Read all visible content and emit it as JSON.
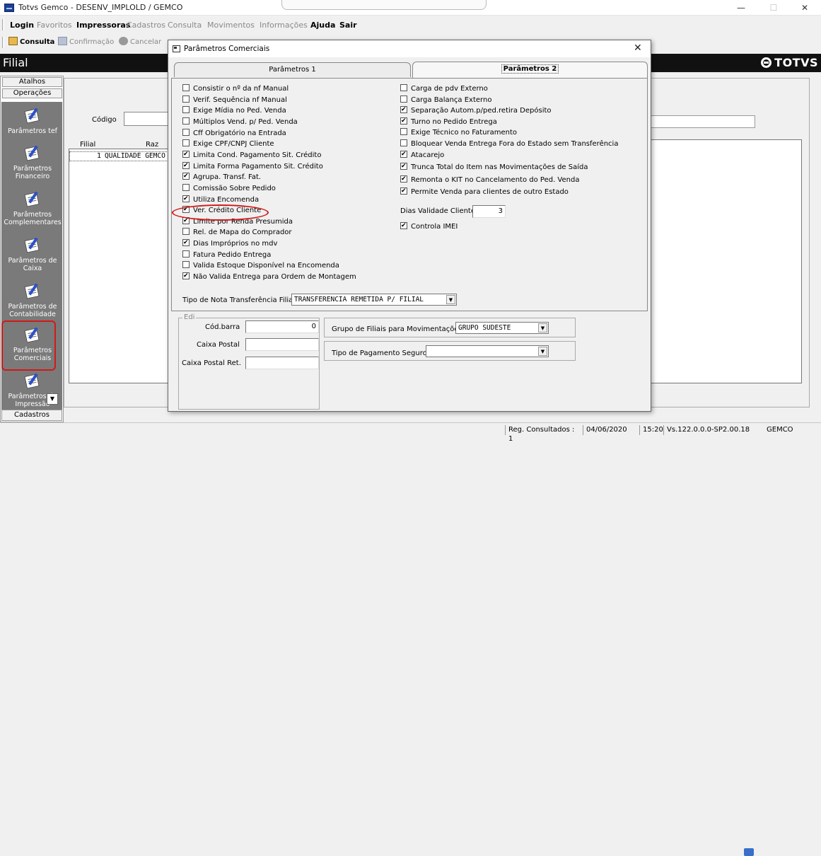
{
  "window": {
    "title": "Totvs Gemco - DESENV_IMPLOLD / GEMCO",
    "controls": [
      "—",
      "☐",
      "✕"
    ]
  },
  "menu": {
    "items": [
      {
        "label": "Login",
        "enabled": true
      },
      {
        "label": "Favoritos",
        "enabled": false
      },
      {
        "label": "Impressoras",
        "enabled": true
      },
      {
        "label": "Cadastros",
        "enabled": false
      },
      {
        "label": "Consulta",
        "enabled": false
      },
      {
        "label": "Movimentos",
        "enabled": false
      },
      {
        "label": "Informações",
        "enabled": false
      },
      {
        "label": "Ajuda",
        "enabled": true
      },
      {
        "label": "Sair",
        "enabled": true
      }
    ]
  },
  "toolbar": {
    "consulta": "Consulta",
    "confirmacao": "Confirmação",
    "cancelar": "Cancelar"
  },
  "header": {
    "title": "Filial",
    "logo": "TOTVS"
  },
  "sidebar": {
    "tabs": [
      "Atalhos",
      "Operações"
    ],
    "items": [
      {
        "label": "Parâmetros tef"
      },
      {
        "label": "Parâmetros Financeiro"
      },
      {
        "label": "Parâmetros Complementares"
      },
      {
        "label": "Parâmetros de Caixa"
      },
      {
        "label": "Parâmetros de Contabilidade"
      },
      {
        "label": "Parâmetros Comerciais"
      },
      {
        "label": "Parâmetros de Impressão"
      }
    ],
    "bottom_tab": "Cadastros"
  },
  "background_form": {
    "codigo_label": "Código",
    "table_headers": [
      "Filial",
      "Raz"
    ],
    "row": {
      "filial": "1",
      "razao": "QUALIDADE GEMCO"
    }
  },
  "dialog": {
    "title": "Parâmetros Comerciais",
    "close": "✕",
    "tabs": [
      "Parâmetros 1",
      "Parâmetros 2"
    ],
    "active_tab": "Parâmetros 2",
    "left_checks": [
      {
        "label": "Consistir o nº da nf Manual",
        "checked": false
      },
      {
        "label": "Verif. Sequência nf Manual",
        "checked": false
      },
      {
        "label": "Exige Mídia no Ped. Venda",
        "checked": false
      },
      {
        "label": "Múltiplos Vend. p/ Ped. Venda",
        "checked": false
      },
      {
        "label": "Cff Obrigatório na Entrada",
        "checked": false
      },
      {
        "label": "Exige CPF/CNPJ Cliente",
        "checked": false
      },
      {
        "label": "Limita Cond. Pagamento Sit. Crédito",
        "checked": true
      },
      {
        "label": "Limita Forma Pagamento Sit. Crédito",
        "checked": true
      },
      {
        "label": "Agrupa. Transf. Fat.",
        "checked": true
      },
      {
        "label": "Comissão Sobre Pedido",
        "checked": false
      },
      {
        "label": "Utiliza Encomenda",
        "checked": true
      },
      {
        "label": "Ver. Crédito Cliente",
        "checked": true
      },
      {
        "label": "Limite por Renda Presumida",
        "checked": true
      },
      {
        "label": "Rel. de Mapa do Comprador",
        "checked": false
      },
      {
        "label": "Dias Impróprios no mdv",
        "checked": true
      },
      {
        "label": "Fatura Pedido Entrega",
        "checked": false
      },
      {
        "label": "Valida Estoque Disponível na Encomenda",
        "checked": false
      },
      {
        "label": "Não Valida Entrega para Ordem de Montagem",
        "checked": true
      }
    ],
    "right_checks": [
      {
        "label": "Carga de pdv Externo",
        "checked": false
      },
      {
        "label": "Carga Balança Externo",
        "checked": false
      },
      {
        "label": "Separação Autom.p/ped.retira Depósito",
        "checked": true
      },
      {
        "label": "Turno no Pedido Entrega",
        "checked": true
      },
      {
        "label": "Exige Técnico no Faturamento",
        "checked": false
      },
      {
        "label": "Bloquear Venda Entrega Fora do Estado sem Transferência",
        "checked": false
      },
      {
        "label": "Atacarejo",
        "checked": true
      },
      {
        "label": "Trunca Total do Item nas Movimentações de Saída",
        "checked": true
      },
      {
        "label": "Remonta o KIT no Cancelamento do Ped. Venda",
        "checked": true
      },
      {
        "label": "Permite Venda para clientes de outro Estado",
        "checked": true
      }
    ],
    "dias_validade": {
      "label": "Dias Validade Cliente",
      "value": "3"
    },
    "controla_imei": {
      "label": "Controla IMEI",
      "checked": true
    },
    "tipo_nota": {
      "label": "Tipo de Nota Transferência Filial",
      "value": "TRANSFERENCIA REMETIDA P/ FILIAL"
    },
    "edi": {
      "legend": "Edi",
      "cod_barra": {
        "label": "Cód.barra",
        "value": "0"
      },
      "caixa_postal": {
        "label": "Caixa Postal",
        "value": ""
      },
      "caixa_postal_ret": {
        "label": "Caixa Postal Ret.",
        "value": ""
      }
    },
    "grupo_filiais": {
      "label": "Grupo de Filiais para Movimentações",
      "value": "GRUPO SUDESTE"
    },
    "tipo_pagamento": {
      "label": "Tipo de Pagamento Seguro",
      "value": ""
    }
  },
  "status": {
    "reg": "Reg. Consultados : 1",
    "date": "04/06/2020",
    "time": "15:20",
    "version": "Vs.122.0.0.0-SP2.00.18",
    "user": "GEMCO"
  }
}
